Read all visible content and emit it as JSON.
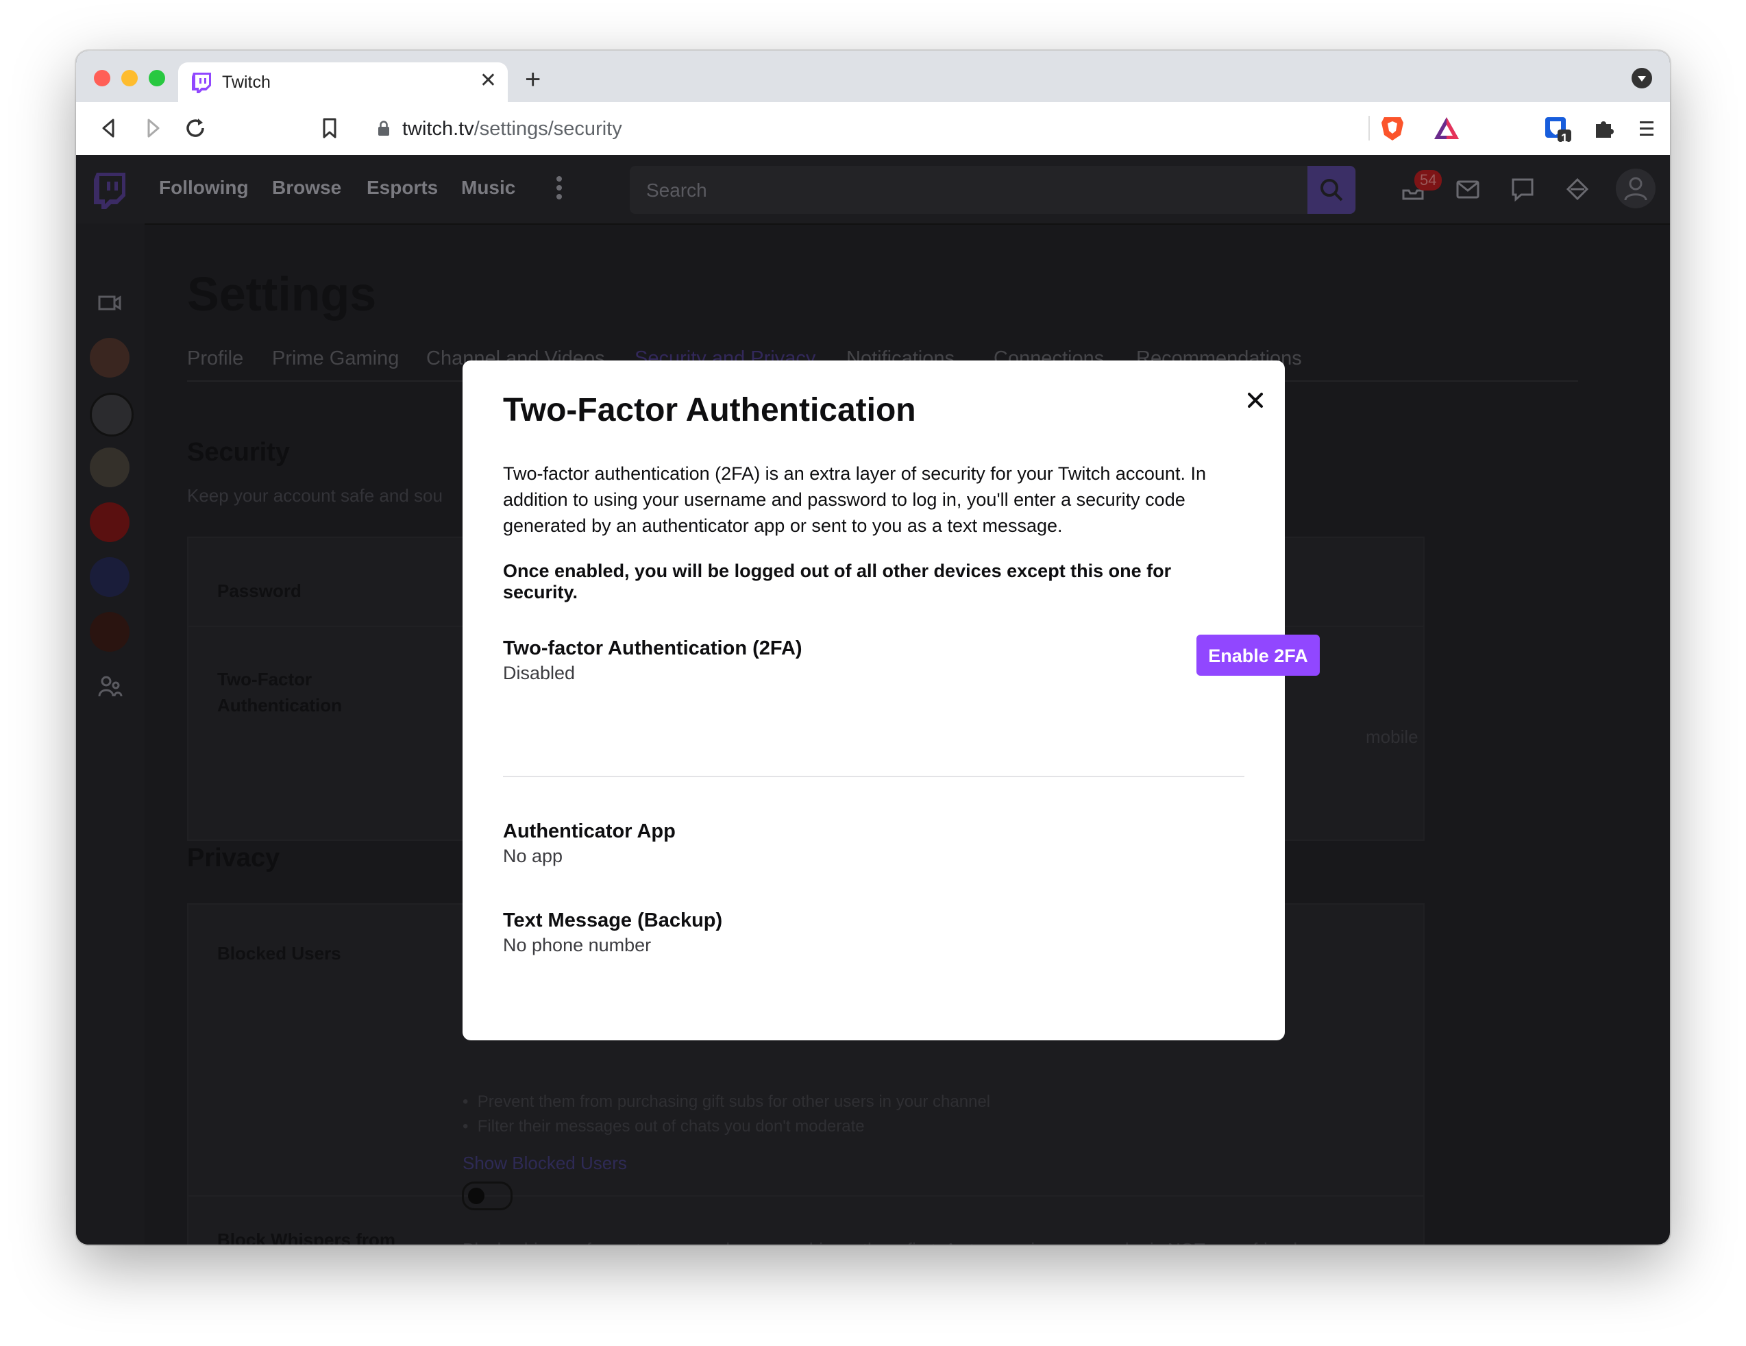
{
  "browser": {
    "tab_title": "Twitch",
    "url_host": "twitch.tv",
    "url_path": "/settings/security",
    "extension_badge": "1"
  },
  "twitch_nav": {
    "links": [
      "Following",
      "Browse",
      "Esports",
      "Music"
    ],
    "search_placeholder": "Search",
    "notification_count": "54"
  },
  "settings": {
    "title": "Settings",
    "tabs": [
      "Profile",
      "Prime Gaming",
      "Channel and Videos",
      "Security and Privacy",
      "Notifications",
      "Connections",
      "Recommendations"
    ],
    "active_tab": "Security and Privacy",
    "security": {
      "heading": "Security",
      "subtitle": "Keep your account safe and sou",
      "password_label": "Password",
      "two_factor_label": "Two-Factor Authentication",
      "mobile_fragment": "mobile"
    },
    "privacy": {
      "heading": "Privacy",
      "blocked_users_label": "Blocked Users",
      "bullet_1": "Prevent them from purchasing gift subs for other users in your channel",
      "bullet_2": "Filter their messages out of chats you don't moderate",
      "show_blocked_link": "Show Blocked Users",
      "block_whispers_label": "Block Whispers from Strangers",
      "block_whispers_desc": "Block whispers from strangers unless you whisper them first. A stranger is anyone who is NOT: your friend,"
    }
  },
  "modal": {
    "title": "Two-Factor Authentication",
    "description": "Two-factor authentication (2FA) is an extra layer of security for your Twitch account. In addition to using your username and password to log in, you'll enter a security code generated by an authenticator app or sent to you as a text message.",
    "warning": "Once enabled, you will be logged out of all other devices except this one for security.",
    "twofa_title": "Two-factor Authentication (2FA)",
    "twofa_status": "Disabled",
    "enable_button": "Enable 2FA",
    "app_title": "Authenticator App",
    "app_status": "No app",
    "sms_title": "Text Message (Backup)",
    "sms_status": "No phone number"
  },
  "colors": {
    "twitch_purple": "#9147ff",
    "overlay": "#18181b"
  }
}
